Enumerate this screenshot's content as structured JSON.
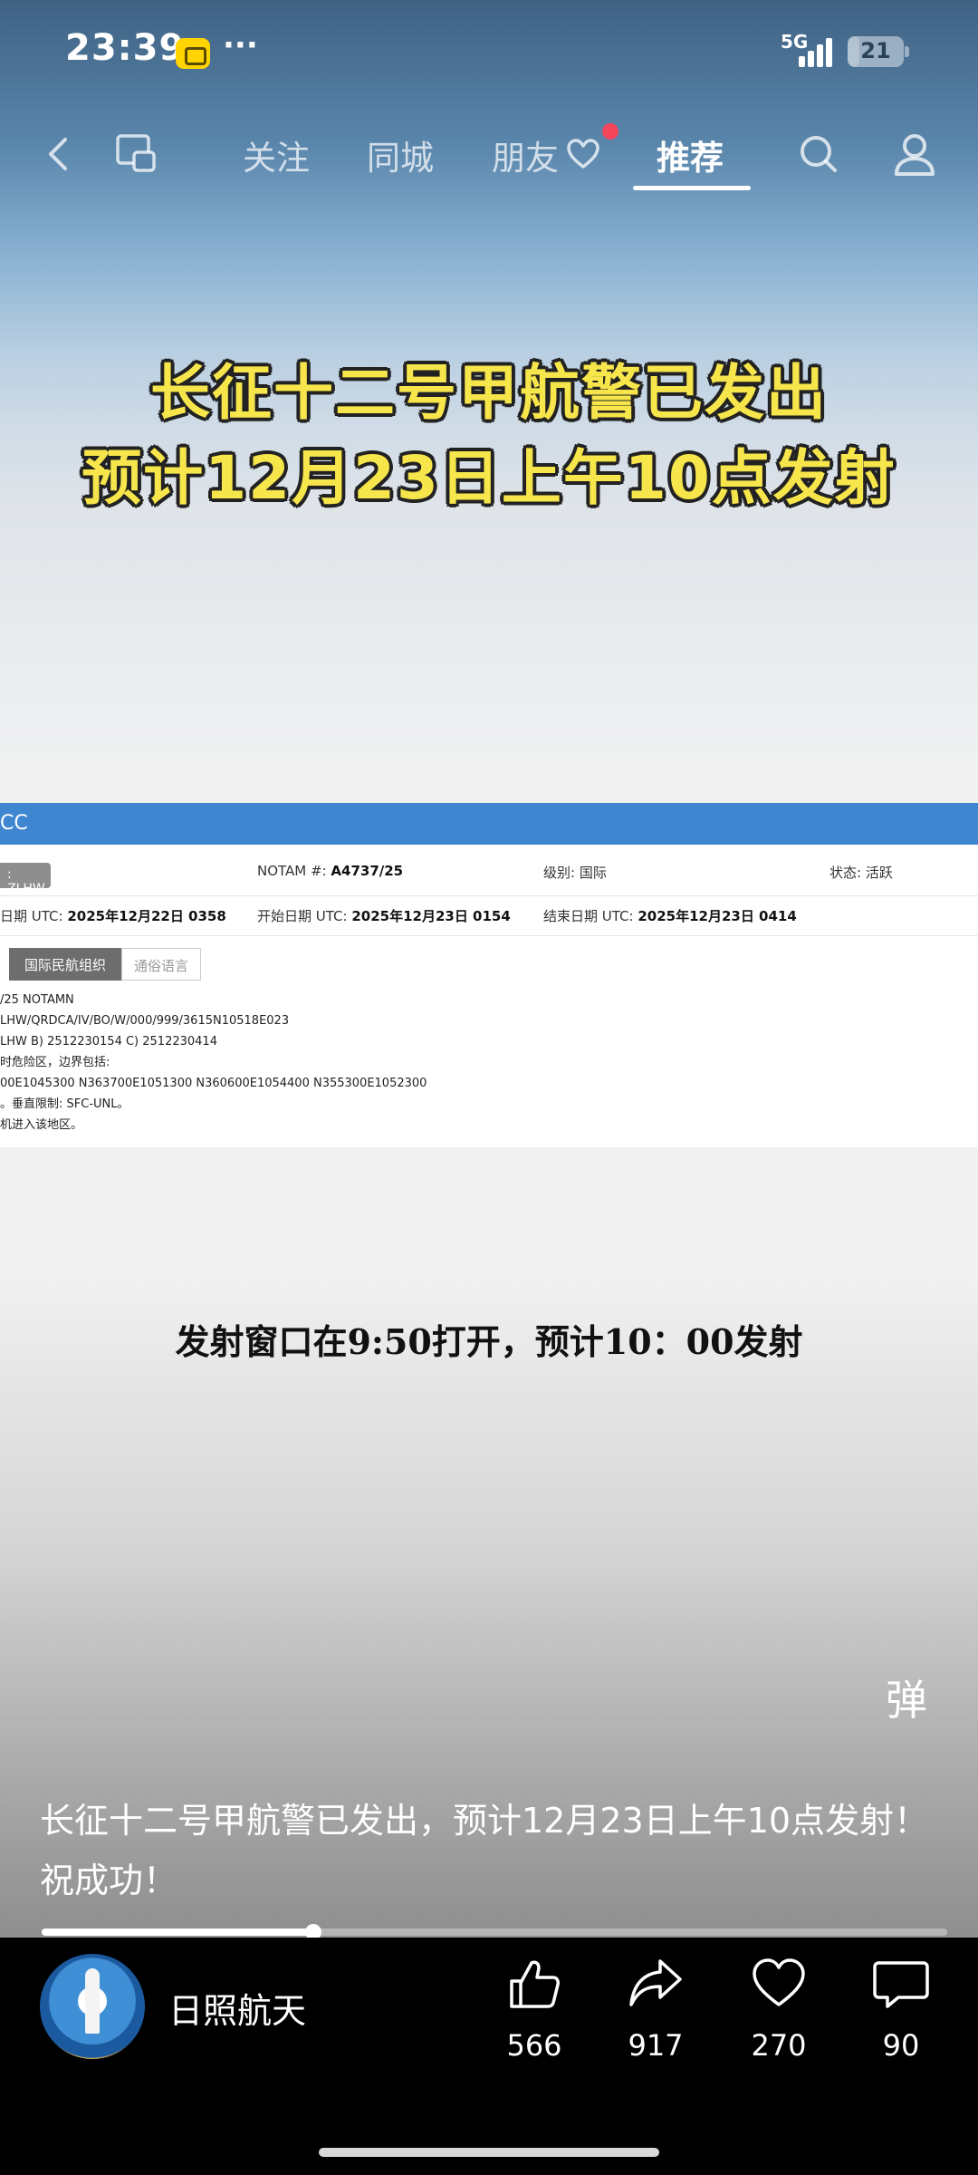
{
  "status_bar": {
    "time": "23:39",
    "more": "···",
    "network": "5G",
    "signal_bars": 4,
    "battery": "21",
    "battery_fraction": 0.21
  },
  "nav": {
    "back_icon": "chevron-left-icon",
    "window_icon": "small-window-icon",
    "tabs": [
      {
        "label": "关注",
        "active": false
      },
      {
        "label": "同城",
        "active": false
      },
      {
        "label": "朋友",
        "active": false
      },
      {
        "label": "推荐",
        "active": true
      }
    ],
    "search_icon": "search-icon",
    "profile_icon": "user-icon",
    "accent": "#f5455b"
  },
  "video": {
    "headline_line1": "长征十二号甲航警已发出",
    "headline_line2": "预计12月23日上午10点发射",
    "headline_color": "#f7e54c",
    "notam": {
      "bar_label": "CC",
      "chip": ": ZLHW",
      "notam_label": "NOTAM #:",
      "notam_value": "A4737/25",
      "level_label": "级别:",
      "level_value": "国际",
      "state_label": "状态:",
      "state_value": "活跃",
      "issue_label": "日期 UTC:",
      "issue_value": "2025年12月22日 0358",
      "start_label": "开始日期 UTC:",
      "start_value": "2025年12月23日 0154",
      "end_label": "结束日期 UTC:",
      "end_value": "2025年12月23日 0414",
      "tab_active": "国际民航组织",
      "tab_inactive": "通俗语言",
      "lines": [
        "/25 NOTAMN",
        "LHW/QRDCA/IV/BO/W/000/999/3615N10518E023",
        "LHW B)  2512230154 C)  2512230414",
        "时危险区，边界包括:",
        "00E1045300 N363700E1051300 N360600E1054400 N355300E1052300",
        "。垂直限制: SFC-UNL。",
        "机进入该地区。"
      ]
    },
    "subtitle": "发射窗口在9:50打开，预计10：00发射",
    "danmaku": "弹"
  },
  "description": "长征十二号甲航警已发出，预计12月23日上午10点发射！祝成功！",
  "progress": 0.3,
  "author": {
    "name": "日照航天",
    "avatar_icon": "rocket-avatar"
  },
  "actions": [
    {
      "icon": "thumbs-up-icon",
      "count": "566"
    },
    {
      "icon": "share-icon",
      "count": "917"
    },
    {
      "icon": "heart-icon",
      "count": "270"
    },
    {
      "icon": "comment-icon",
      "count": "90"
    }
  ]
}
